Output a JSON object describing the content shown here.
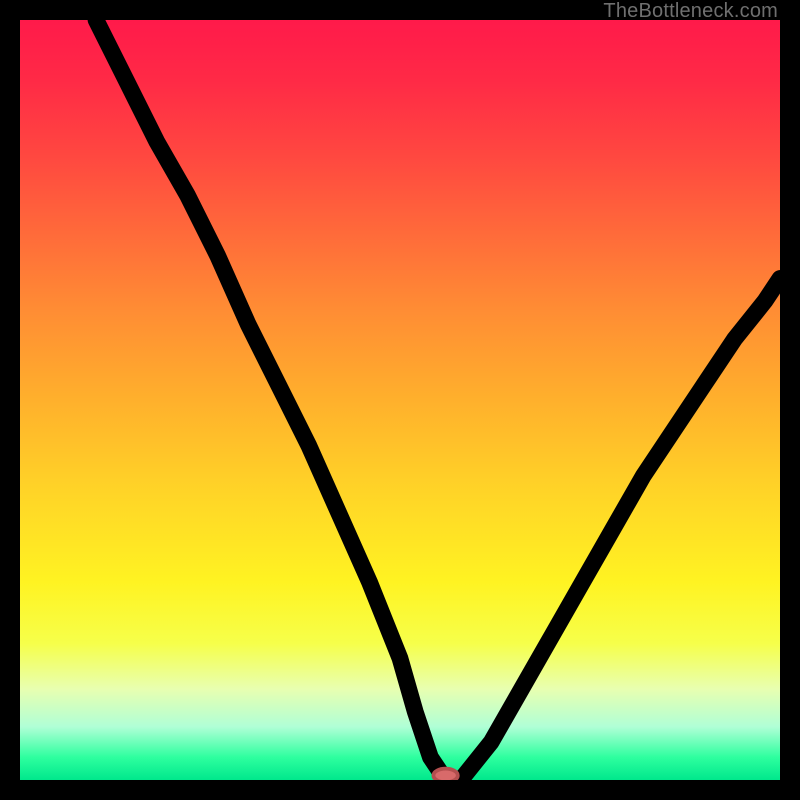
{
  "watermark": "TheBottleneck.com",
  "chart_data": {
    "type": "line",
    "title": "",
    "xlabel": "",
    "ylabel": "",
    "xlim": [
      0,
      100
    ],
    "ylim": [
      0,
      100
    ],
    "grid": false,
    "series": [
      {
        "name": "bottleneck-curve",
        "x": [
          10,
          14,
          18,
          22,
          26,
          30,
          34,
          38,
          42,
          46,
          50,
          52,
          54,
          56,
          58,
          62,
          66,
          70,
          74,
          78,
          82,
          86,
          90,
          94,
          98,
          100
        ],
        "values": [
          100,
          92,
          84,
          77,
          69,
          60,
          52,
          44,
          35,
          26,
          16,
          9,
          3,
          0,
          0,
          5,
          12,
          19,
          26,
          33,
          40,
          46,
          52,
          58,
          63,
          66
        ]
      }
    ],
    "marker": {
      "x": 56,
      "y": 0,
      "rx": 1.6,
      "ry": 0.9
    },
    "background": {
      "type": "vertical-gradient",
      "stops": [
        {
          "pos": 0,
          "color": "#ff1a4a"
        },
        {
          "pos": 50,
          "color": "#ffb02c"
        },
        {
          "pos": 80,
          "color": "#f6ff4a"
        },
        {
          "pos": 100,
          "color": "#00e88c"
        }
      ]
    }
  }
}
